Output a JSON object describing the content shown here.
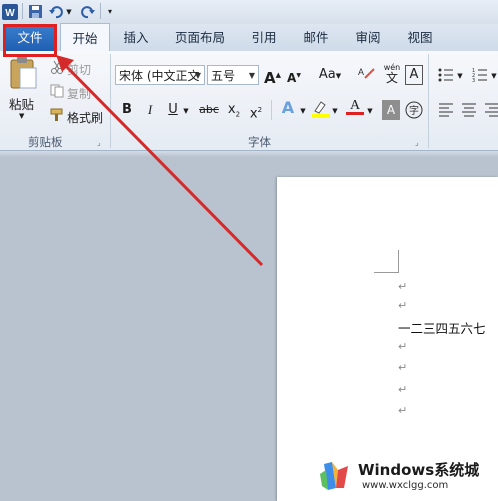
{
  "quick_access": {
    "word_icon": "W-icon"
  },
  "tabs": [
    {
      "label": "文件"
    },
    {
      "label": "开始"
    },
    {
      "label": "插入"
    },
    {
      "label": "页面布局"
    },
    {
      "label": "引用"
    },
    {
      "label": "邮件"
    },
    {
      "label": "审阅"
    },
    {
      "label": "视图"
    }
  ],
  "clipboard": {
    "paste": "粘贴",
    "cut": "剪切",
    "copy": "复制",
    "format_painter": "格式刷",
    "group": "剪贴板"
  },
  "font": {
    "name": "宋体 (中文正文",
    "size": "五号",
    "group": "字体",
    "case_btn": "Aa",
    "wen": "wén",
    "wen_char": "文",
    "A_box": "A",
    "zi": "字"
  },
  "document": {
    "text": "一二三四五六七",
    "para_mark": "↵"
  },
  "watermark": {
    "brand": "Windows系统城",
    "url": "www.wxclgg.com"
  },
  "colors": {
    "file_tab": "#2b6fc4",
    "highlight": "#e02020",
    "arrow": "#d42a2a"
  }
}
